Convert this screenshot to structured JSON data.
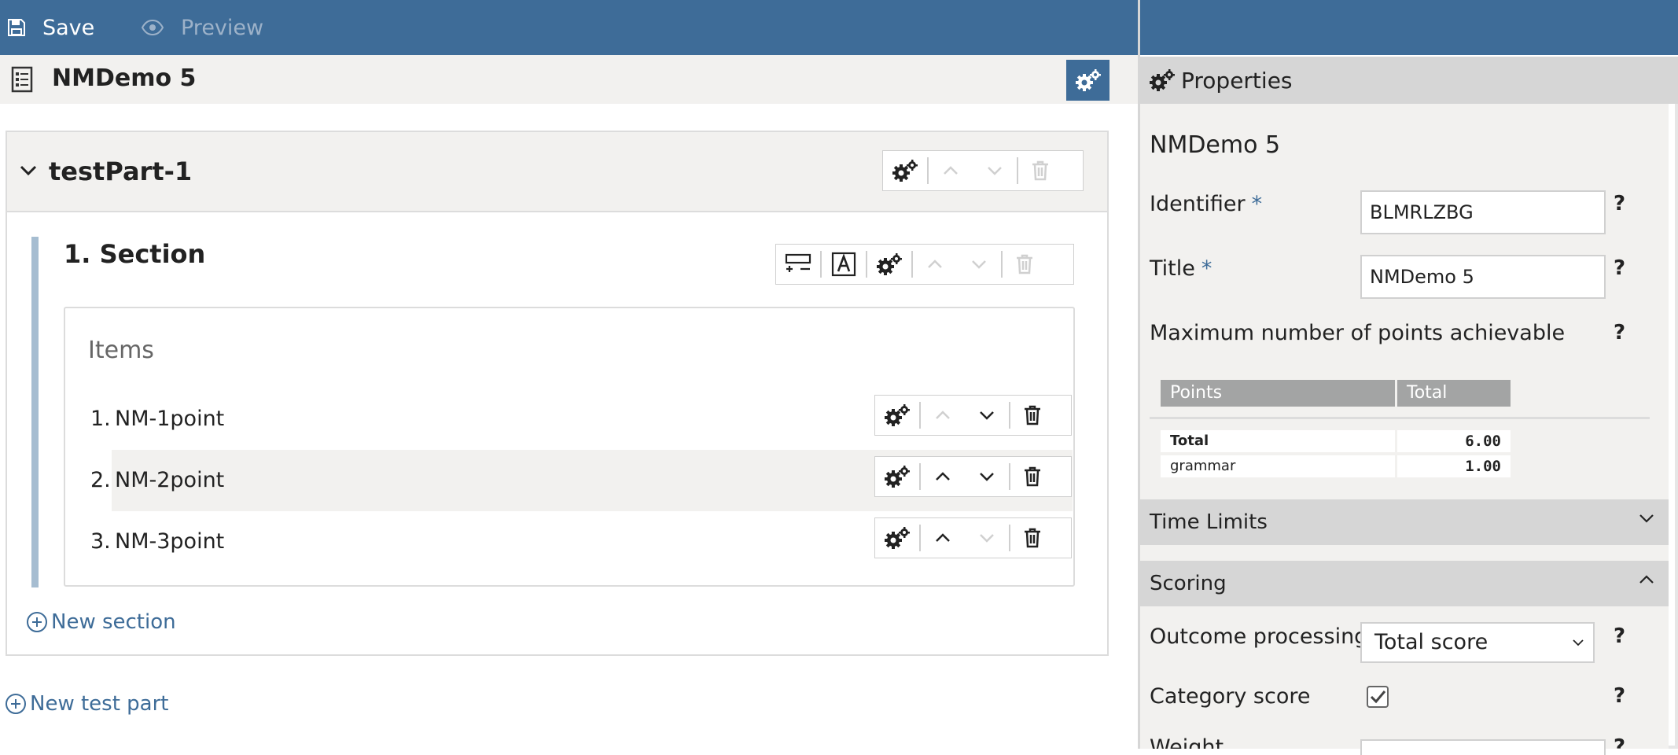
{
  "toolbar": {
    "save_label": "Save",
    "preview_label": "Preview"
  },
  "test": {
    "title": "NMDemo 5"
  },
  "test_part": {
    "name": "testPart-1"
  },
  "section": {
    "title": "1. Section",
    "items_label": "Items",
    "items": [
      {
        "num": "1.",
        "name": "NM-1point"
      },
      {
        "num": "2.",
        "name": "NM-2point"
      },
      {
        "num": "3.",
        "name": "NM-3point"
      }
    ]
  },
  "links": {
    "new_section": "New section",
    "new_test_part": "New test part"
  },
  "properties": {
    "header": "Properties",
    "title": "NMDemo 5",
    "identifier_label": "Identifier",
    "identifier_value": "BLMRLZBG",
    "title_label": "Title",
    "title_value": "NMDemo 5",
    "required_mark": "*",
    "help_mark": "?",
    "max_points_label": "Maximum number of points achievable",
    "points_table": {
      "headers": [
        "Points",
        "Total"
      ],
      "rows": [
        {
          "label": "Total",
          "value": "6.00"
        },
        {
          "label": "grammar",
          "value": "1.00"
        }
      ]
    },
    "time_limits_label": "Time Limits",
    "scoring_label": "Scoring",
    "outcome_processing_label": "Outcome processing",
    "outcome_processing_value": "Total score",
    "category_score_label": "Category score",
    "category_score_checked": true,
    "next_label_partial": "Weight"
  },
  "colors": {
    "toolbar": "#3e6c98",
    "link": "#3e6c98",
    "section_bar": "#a6bdd1"
  }
}
